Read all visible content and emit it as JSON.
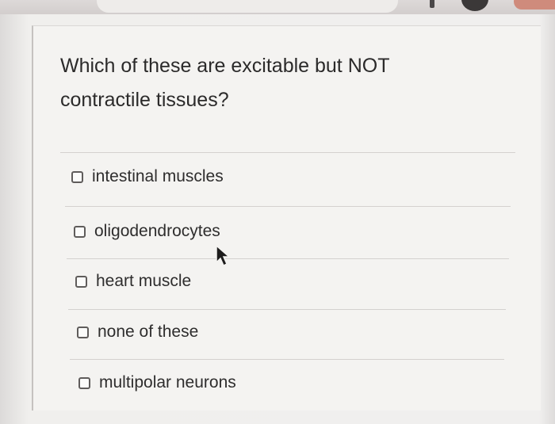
{
  "question": {
    "line1": "Which of these are excitable but NOT",
    "line2": "contractile tissues?"
  },
  "options": [
    {
      "label": "intestinal muscles",
      "checked": false
    },
    {
      "label": "oligodendrocytes",
      "checked": false
    },
    {
      "label": "heart muscle",
      "checked": false
    },
    {
      "label": "none of these",
      "checked": false
    },
    {
      "label": "multipolar neurons",
      "checked": false
    }
  ],
  "colors": {
    "text": "#2b2a2a",
    "card_background": "#f4f3f1",
    "divider": "#d4d1cf",
    "checkbox_border": "#5f5c5b"
  },
  "icons": {
    "cursor": "mouse-pointer-icon",
    "checkbox": "checkbox-icon"
  }
}
